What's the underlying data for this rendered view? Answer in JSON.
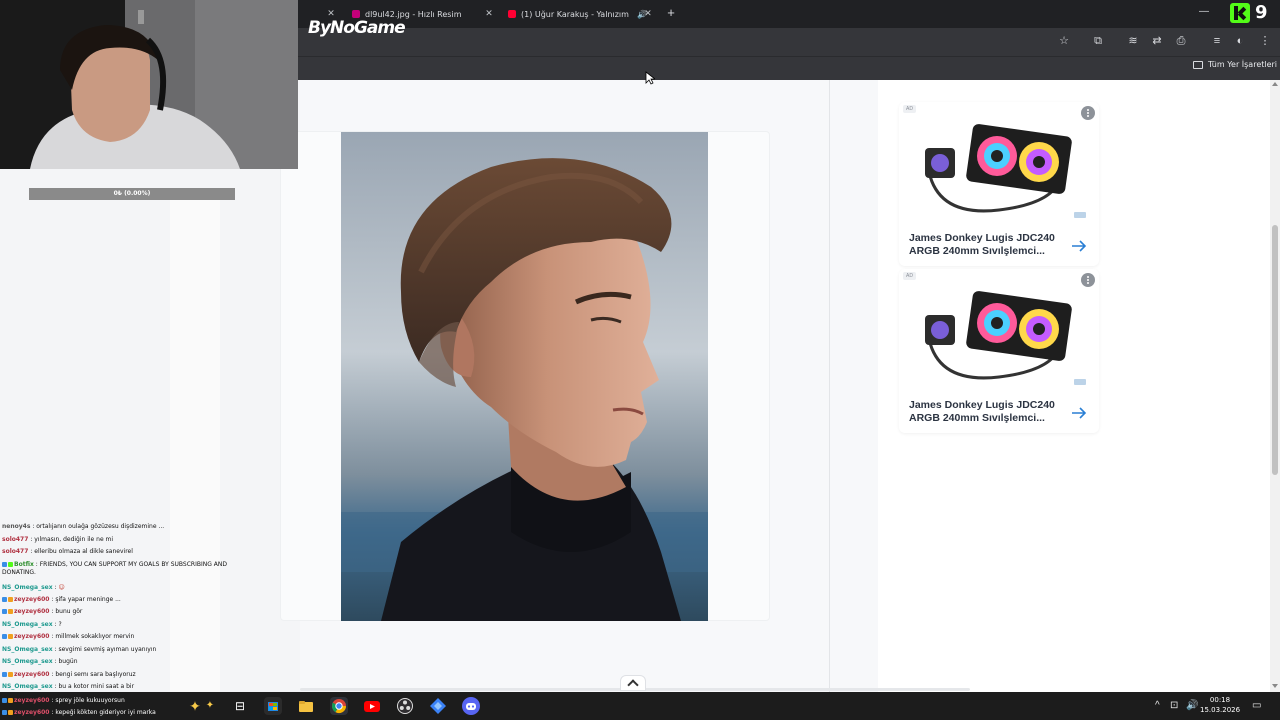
{
  "browser": {
    "tabs": [
      {
        "title": "dl9ul42.jpg - Hızlı Resim",
        "favicon_color": "#c4007a"
      },
      {
        "title": "(1) Uğur Karakuş - Yalnızım",
        "favicon_color": "#ff0033"
      }
    ],
    "overlay_logo": "ByNoGame",
    "bookmarks_folder": "Tüm Yer İşaretleri"
  },
  "stream_overlay": {
    "kick_count": "9",
    "progress_text": "0₺ (0.00%)"
  },
  "ads": [
    {
      "badge": "AD",
      "title_line1": "James Donkey Lugis JDC240",
      "title_line2": "ARGB 240mm Sıvılşlemci..."
    },
    {
      "badge": "AD",
      "title_line1": "James Donkey Lugis JDC240",
      "title_line2": "ARGB 240mm Sıvılşlemci..."
    }
  ],
  "chat": {
    "messages": [
      {
        "user": "nenoy4s",
        "text": "ortalıjanın oulağa gözüzesu dişdizemine ...",
        "color": "#555555"
      },
      {
        "user": "solo477",
        "text": "yılmasın, dediğin ile ne mi",
        "color": "#b03040"
      },
      {
        "user": "solo477",
        "text": "elleribu olmaza al dikle sanevirel",
        "color": "#b03040"
      },
      {
        "user": "Botfix",
        "text": "FRIENDS, YOU CAN SUPPORT MY GOALS BY SUBSCRIBING AND DONATING.",
        "color": "#2f8f2f"
      },
      {
        "user": "NS_Omega_sex",
        "text": ":",
        "color": "#1f9a8f"
      },
      {
        "user": "zeyzey600",
        "text": "şifa yapar meninge ...",
        "color": "#b03040"
      },
      {
        "user": "zeyzey600",
        "text": "bunu gör",
        "color": "#b03040"
      },
      {
        "user": "NS_Omega_sex",
        "text": ": ?",
        "color": "#1f9a8f"
      },
      {
        "user": "zeyzey600",
        "text": "millmek sokaklıyor mervin",
        "color": "#b03040"
      },
      {
        "user": "NS_Omega_sex",
        "text": "sevgimi sevmiş ayıman uyanıyın",
        "color": "#1f9a8f"
      },
      {
        "user": "NS_Omega_sex",
        "text": "bugün",
        "color": "#1f9a8f"
      },
      {
        "user": "zeyzey600",
        "text": "bengi semı sara başlıyoruz",
        "color": "#b03040"
      },
      {
        "user": "NS_Omega_sex",
        "text": "bu a kotor mini saat a bir",
        "color": "#1f9a8f"
      },
      {
        "user": "zeyzey600",
        "text": "sprey jöle kukuuyorsun",
        "color": "#b03040"
      },
      {
        "user": "zeyzey600",
        "text": "kepeği kökten gideriyor iyi marka",
        "color": "#b03040"
      }
    ]
  },
  "taskbar": {
    "time": "00:18",
    "date": "15.03.2026",
    "apps": [
      "start",
      "copilot",
      "task-view",
      "store",
      "explorer",
      "chrome",
      "youtube",
      "obs",
      "app-blue",
      "discord"
    ]
  }
}
